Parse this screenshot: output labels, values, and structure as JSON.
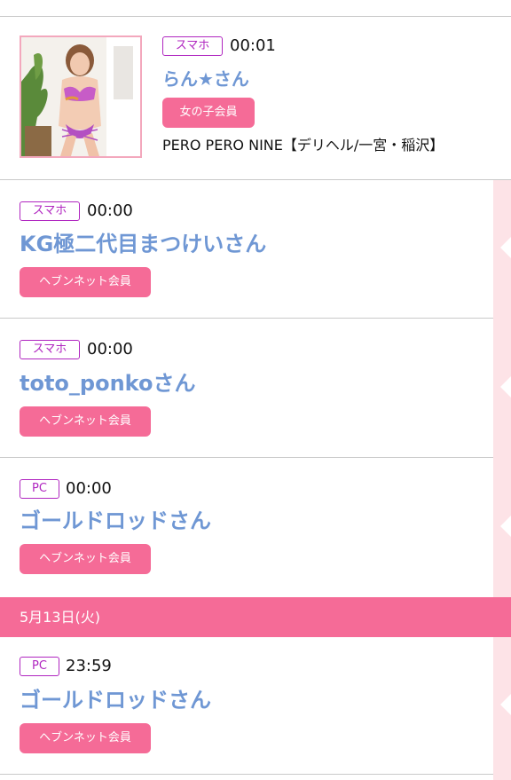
{
  "entries": [
    {
      "device": "スマホ",
      "time": "00:01",
      "name": "らん★さん",
      "member": "女の子会員",
      "shop": "PERO PERO NINE【デリヘル/一宮・稲沢】",
      "avatar_icon": "girl-photo"
    },
    {
      "device": "スマホ",
      "time": "00:00",
      "name": "KG極二代目まつけいさん",
      "member": "ヘブンネット会員"
    },
    {
      "device": "スマホ",
      "time": "00:00",
      "name": "toto_ponkoさん",
      "member": "ヘブンネット会員"
    },
    {
      "device": "PC",
      "time": "00:00",
      "name": "ゴールドロッドさん",
      "member": "ヘブンネット会員"
    }
  ],
  "date_divider": "5月13日(火)",
  "entries_after_date": [
    {
      "device": "PC",
      "time": "23:59",
      "name": "ゴールドロッドさん",
      "member": "ヘブンネット会員"
    }
  ],
  "colors": {
    "accent_pink": "#f56b97",
    "tag_purple": "#b026c0",
    "name_blue": "#6f97d4",
    "sidebar_pink": "#fde3e7"
  }
}
